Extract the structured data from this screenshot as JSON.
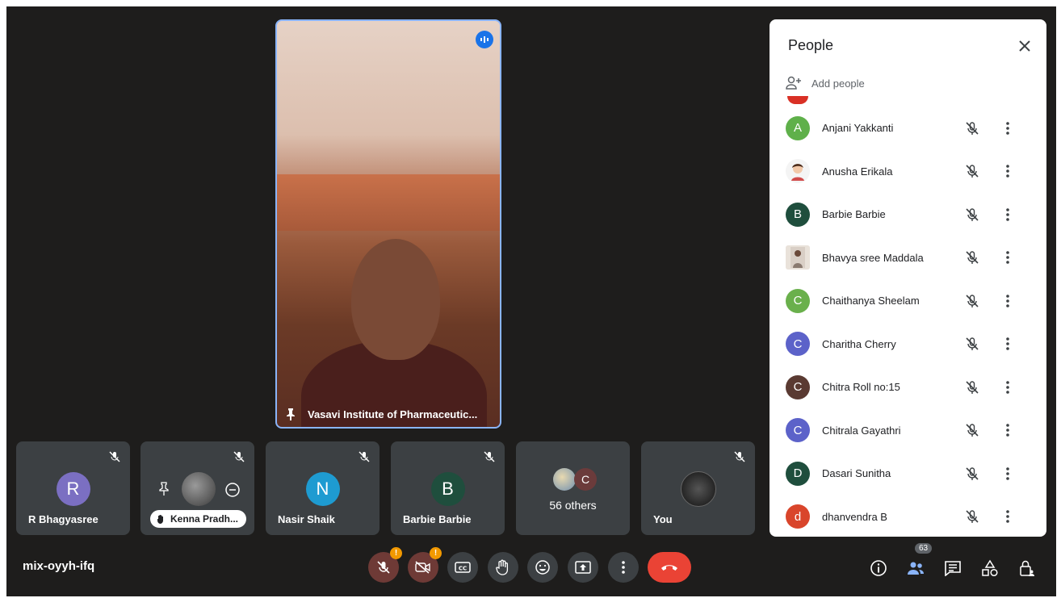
{
  "meeting": {
    "code": "mix-oyyh-ifq"
  },
  "speaker": {
    "name": "Vasavi Institute of Pharmaceutic..."
  },
  "tiles": [
    {
      "name": "R Bhagyasree",
      "initial": "R",
      "color": "#7b6fc2"
    },
    {
      "name": "Kenna Pradh..."
    },
    {
      "name": "Nasir Shaik",
      "initial": "N",
      "color": "#1e9bd1"
    },
    {
      "name": "Barbie Barbie",
      "initial": "B",
      "color": "#1f4e3d"
    },
    {
      "others_label": "56 others",
      "initial": "C",
      "color": "#6b3b3b"
    },
    {
      "name": "You"
    }
  ],
  "panel": {
    "title": "People",
    "add_label": "Add people",
    "participant_count": "63",
    "participants": [
      {
        "name": "Anjani Yakkanti",
        "initial": "A",
        "color": "#5fb04a"
      },
      {
        "name": "Anusha Erikala",
        "initial": "",
        "color": "#f4f4f4"
      },
      {
        "name": "Barbie Barbie",
        "initial": "B",
        "color": "#1f4e3d"
      },
      {
        "name": "Bhavya sree Maddala",
        "initial": "",
        "color": "#d9cfc6"
      },
      {
        "name": "Chaithanya Sheelam",
        "initial": "C",
        "color": "#6ab04c"
      },
      {
        "name": "Charitha Cherry",
        "initial": "C",
        "color": "#5c62c9"
      },
      {
        "name": "Chitra Roll no:15",
        "initial": "C",
        "color": "#5a3a32"
      },
      {
        "name": "Chitrala Gayathri",
        "initial": "C",
        "color": "#5c62c9"
      },
      {
        "name": "Dasari Sunitha",
        "initial": "D",
        "color": "#1f4e3d"
      },
      {
        "name": "dhanvendra B",
        "initial": "d",
        "color": "#d9452b"
      }
    ]
  }
}
